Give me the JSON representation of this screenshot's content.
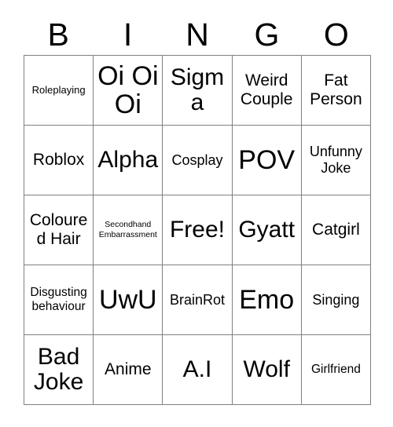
{
  "card": {
    "header_letters": [
      "B",
      "I",
      "N",
      "G",
      "O"
    ],
    "columns": 5,
    "rows": 5,
    "border_color": "#808080",
    "text_color": "#000000",
    "background_color": "#ffffff",
    "cells": [
      {
        "text": "Roleplaying",
        "size": "fs-xs"
      },
      {
        "text": "Oi Oi Oi",
        "size": "fs-3xl"
      },
      {
        "text": "Sigma",
        "size": "fs-xxl"
      },
      {
        "text": "Weird Couple",
        "size": "fs-l"
      },
      {
        "text": "Fat Person",
        "size": "fs-l"
      },
      {
        "text": "Roblox",
        "size": "fs-l"
      },
      {
        "text": "Alpha",
        "size": "fs-xxl"
      },
      {
        "text": "Cosplay",
        "size": "fs-m"
      },
      {
        "text": "POV",
        "size": "fs-3xl"
      },
      {
        "text": "Unfunny Joke",
        "size": "fs-m"
      },
      {
        "text": "Coloured Hair",
        "size": "fs-l"
      },
      {
        "text": "Secondhand Embarrassment",
        "size": "fs-xxs"
      },
      {
        "text": "Free!",
        "size": "fs-xxl"
      },
      {
        "text": "Gyatt",
        "size": "fs-xxl"
      },
      {
        "text": "Catgirl",
        "size": "fs-l"
      },
      {
        "text": "Disgusting behaviour",
        "size": "fs-s"
      },
      {
        "text": "UwU",
        "size": "fs-3xl"
      },
      {
        "text": "BrainRot",
        "size": "fs-m"
      },
      {
        "text": "Emo",
        "size": "fs-3xl"
      },
      {
        "text": "Singing",
        "size": "fs-m"
      },
      {
        "text": "Bad Joke",
        "size": "fs-xxl"
      },
      {
        "text": "Anime",
        "size": "fs-l"
      },
      {
        "text": "A.I",
        "size": "fs-xxl"
      },
      {
        "text": "Wolf",
        "size": "fs-xxl"
      },
      {
        "text": "Girlfriend",
        "size": "fs-s"
      }
    ]
  }
}
